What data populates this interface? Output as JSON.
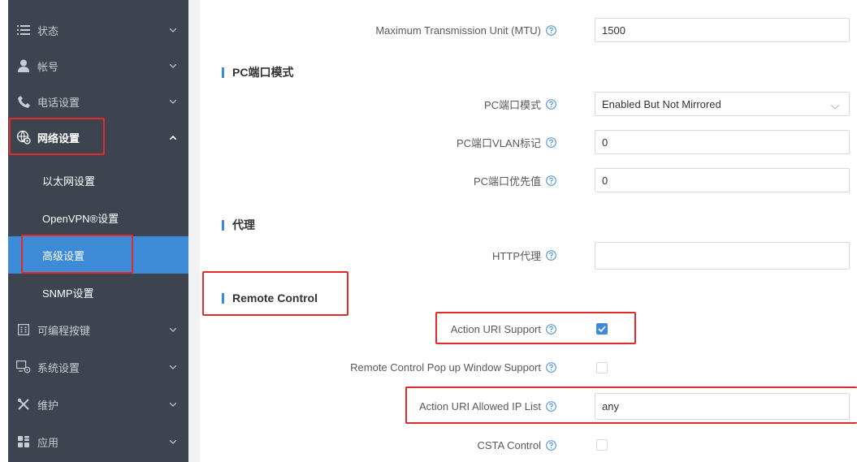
{
  "sidebar": {
    "items": [
      {
        "label": "状态",
        "icon": "list-icon"
      },
      {
        "label": "帐号",
        "icon": "user-icon"
      },
      {
        "label": "电话设置",
        "icon": "phone-icon"
      },
      {
        "label": "网络设置",
        "icon": "network-icon"
      },
      {
        "label": "可编程按键",
        "icon": "keypad-icon"
      },
      {
        "label": "系统设置",
        "icon": "system-settings-icon"
      },
      {
        "label": "维护",
        "icon": "tools-icon"
      },
      {
        "label": "应用",
        "icon": "apps-icon"
      }
    ],
    "sub_items": [
      {
        "label": "以太网设置"
      },
      {
        "label": "OpenVPN®设置"
      },
      {
        "label": "高级设置"
      },
      {
        "label": "SNMP设置"
      }
    ]
  },
  "main": {
    "mtu": {
      "label": "Maximum Transmission Unit (MTU)",
      "value": "1500"
    },
    "pc_section": {
      "title": "PC端口模式"
    },
    "pc_port_mode": {
      "label": "PC端口模式",
      "value": "Enabled But Not Mirrored"
    },
    "pc_vlan_tag": {
      "label": "PC端口VLAN标记",
      "value": "0"
    },
    "pc_priority": {
      "label": "PC端口优先值",
      "value": "0"
    },
    "proxy_section": {
      "title": "代理"
    },
    "http_proxy": {
      "label": "HTTP代理",
      "value": ""
    },
    "remote_section": {
      "title": "Remote Control"
    },
    "action_uri_support": {
      "label": "Action URI Support",
      "checked": true
    },
    "popup_support": {
      "label": "Remote Control Pop up Window Support",
      "checked": false
    },
    "allowed_ip": {
      "label": "Action URI Allowed IP List",
      "value": "any"
    },
    "csta": {
      "label": "CSTA Control",
      "checked": false
    }
  },
  "colors": {
    "sidebar_bg": "#3d4450",
    "accent": "#3d8bd6",
    "highlight": "#e02b2b"
  }
}
